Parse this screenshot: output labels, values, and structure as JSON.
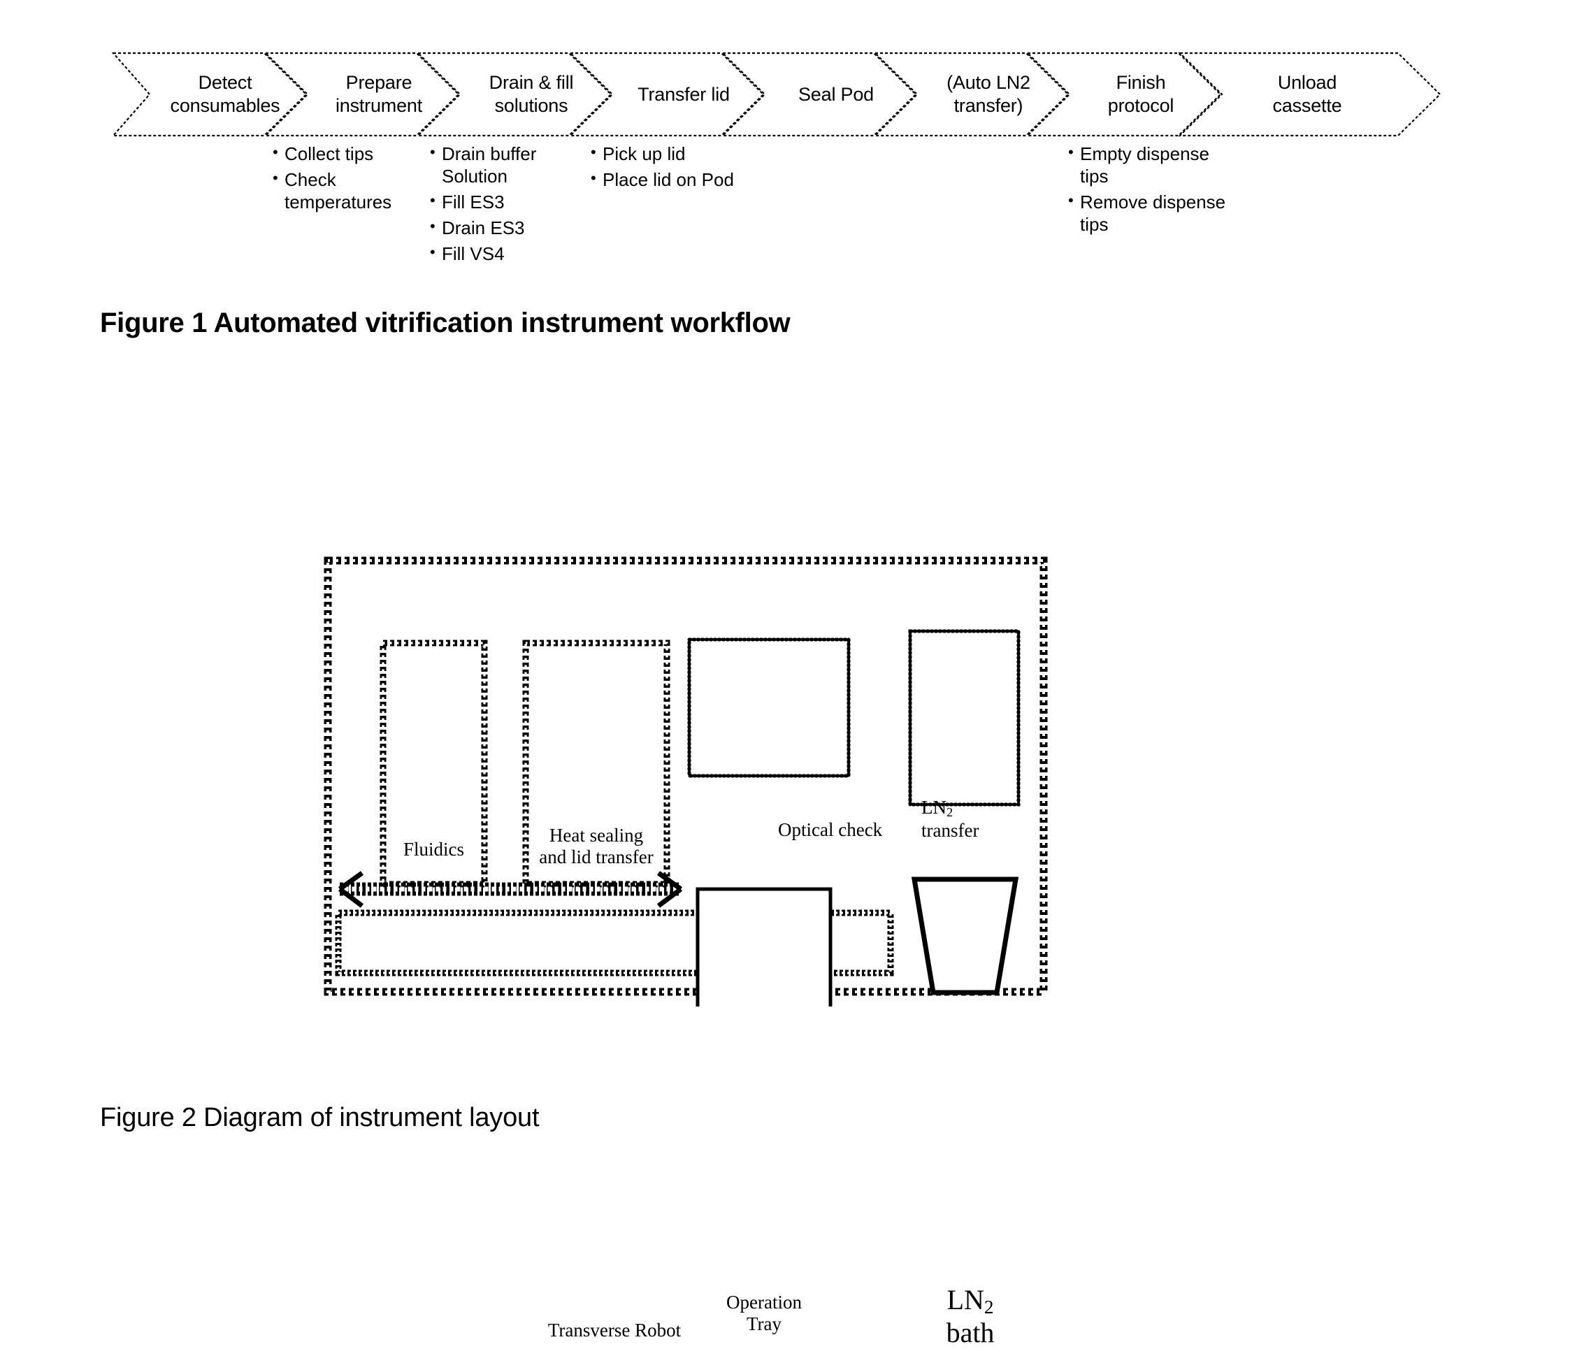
{
  "figure1": {
    "caption": "Figure 1 Automated vitrification instrument workflow",
    "steps": [
      {
        "label": "Detect\nconsumables",
        "bullets": []
      },
      {
        "label": "Prepare\ninstrument",
        "bullets": [
          "Collect tips",
          "Check temperatures"
        ]
      },
      {
        "label": "Drain & fill\nsolutions",
        "bullets": [
          "Drain buffer Solution",
          "Fill ES3",
          "Drain ES3",
          "Fill VS4"
        ]
      },
      {
        "label": "Transfer lid",
        "bullets": [
          "Pick up lid",
          "Place lid on Pod"
        ]
      },
      {
        "label": "Seal Pod",
        "bullets": []
      },
      {
        "label": "(Auto LN2\ntransfer)",
        "bullets": []
      },
      {
        "label": "Finish\nprotocol",
        "bullets": [
          "Empty dispense tips",
          "Remove dispense tips"
        ]
      },
      {
        "label": "Unload\ncassette",
        "bullets": []
      }
    ]
  },
  "figure2": {
    "caption": "Figure 2 Diagram of instrument layout",
    "boxes": {
      "fluidics": "Fluidics",
      "heat_sealing_line1": "Heat sealing",
      "heat_sealing_line2": "and lid transfer",
      "optical_check": "Optical check",
      "ln2_transfer_line1": "LN",
      "ln2_transfer_sub": "2",
      "ln2_transfer_line2": "transfer",
      "transverse_robot": "Transverse Robot",
      "operation_tray_line1": "Operation",
      "operation_tray_line2": "Tray",
      "ln2_bath_line1": "LN",
      "ln2_bath_sub": "2",
      "ln2_bath_line2": "bath"
    }
  },
  "colors": {
    "ink": "#000000",
    "paper": "#ffffff"
  }
}
